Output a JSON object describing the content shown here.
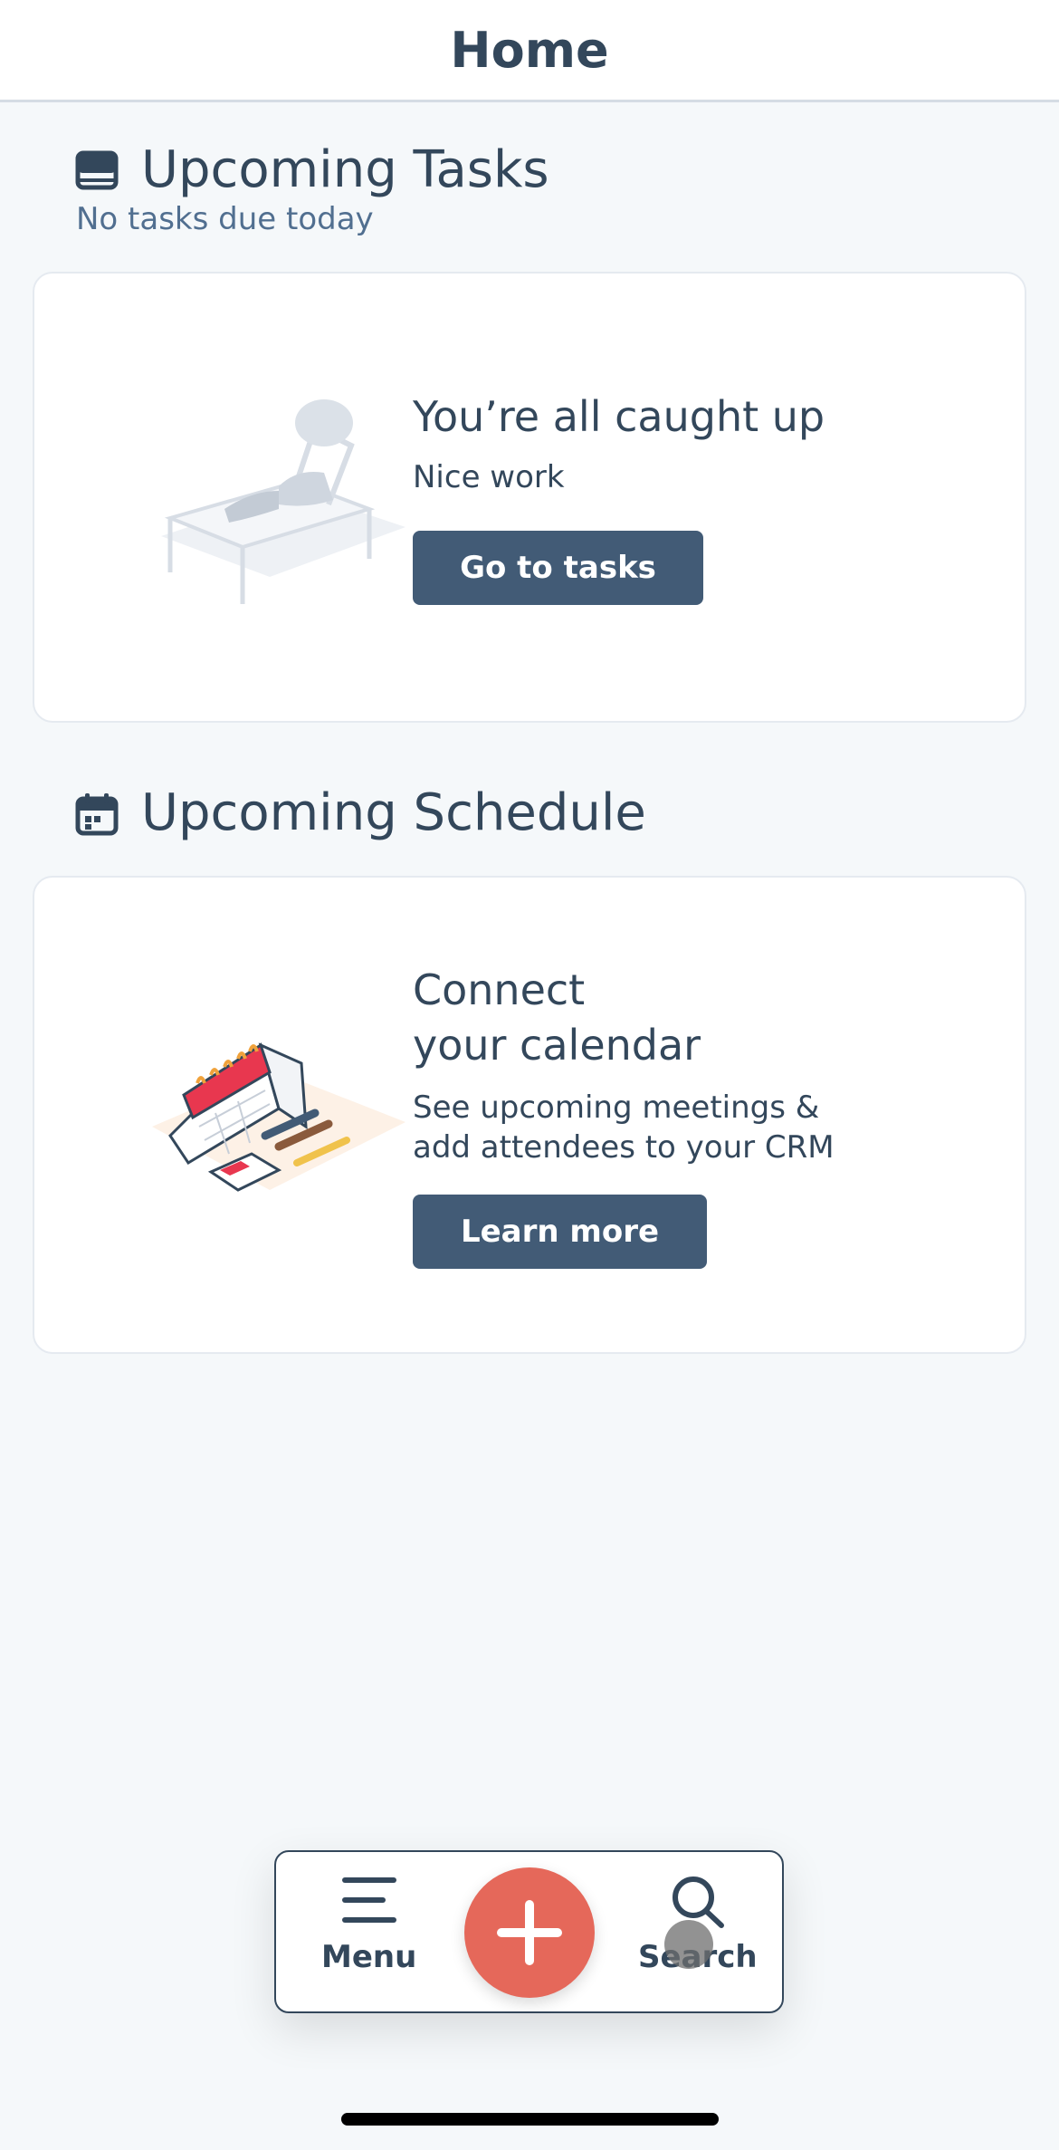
{
  "header": {
    "title": "Home"
  },
  "tasks": {
    "title": "Upcoming Tasks",
    "subtitle": "No tasks due today",
    "icon": "inbox-tray-icon",
    "card": {
      "heading": "You’re all caught up",
      "body": "Nice work",
      "button": "Go to tasks",
      "illustration": "relaxing-person-illustration"
    }
  },
  "schedule": {
    "title": "Upcoming Schedule",
    "icon": "calendar-icon",
    "card": {
      "heading": "Connect\nyour calendar",
      "body": "See upcoming meetings &\nadd attendees to your CRM",
      "button": "Learn more",
      "illustration": "desk-calendar-illustration"
    }
  },
  "bottom_nav": {
    "menu_label": "Menu",
    "search_label": "Search",
    "add_icon": "plus-icon"
  },
  "colors": {
    "primary_button": "#425b76",
    "fab": "#e5685a",
    "text": "#33475b",
    "background": "#f5f8fa"
  }
}
